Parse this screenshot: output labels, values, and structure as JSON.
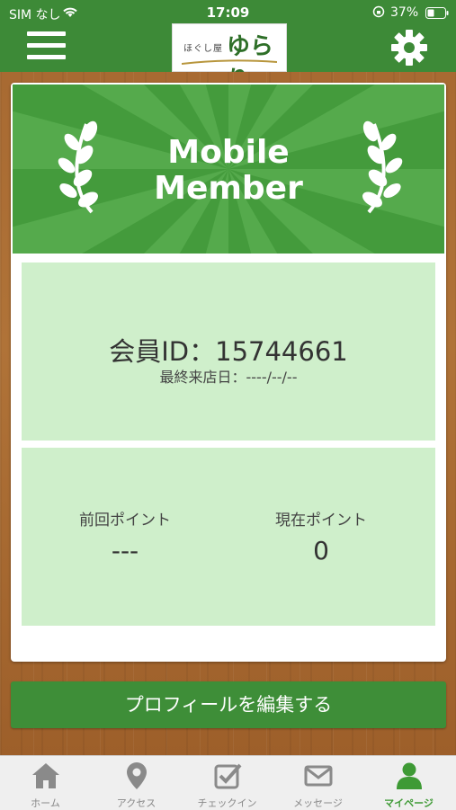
{
  "status_bar": {
    "carrier": "SIM なし",
    "time": "17:09",
    "battery": "37%"
  },
  "header": {
    "logo_small": "ほぐし屋",
    "logo_big": "ゆらり"
  },
  "banner": {
    "title_line1": "Mobile",
    "title_line2": "Member"
  },
  "member": {
    "id_text": "会員ID：15744661",
    "last_visit": "最終来店日：----/--/--"
  },
  "points": {
    "previous_label": "前回ポイント",
    "previous_value": "---",
    "current_label": "現在ポイント",
    "current_value": "0"
  },
  "edit_profile_label": "プロフィールを編集する",
  "tabs": [
    {
      "label": "ホーム",
      "icon": "home-icon"
    },
    {
      "label": "アクセス",
      "icon": "map-pin-icon"
    },
    {
      "label": "チェックイン",
      "icon": "checkin-icon"
    },
    {
      "label": "メッセージ",
      "icon": "mail-icon"
    },
    {
      "label": "マイページ",
      "icon": "user-icon"
    }
  ],
  "colors": {
    "brand_green": "#3d8a37",
    "banner_green": "#449b3c",
    "panel_green": "#cfefcb",
    "active_tab": "#3e9a35"
  }
}
